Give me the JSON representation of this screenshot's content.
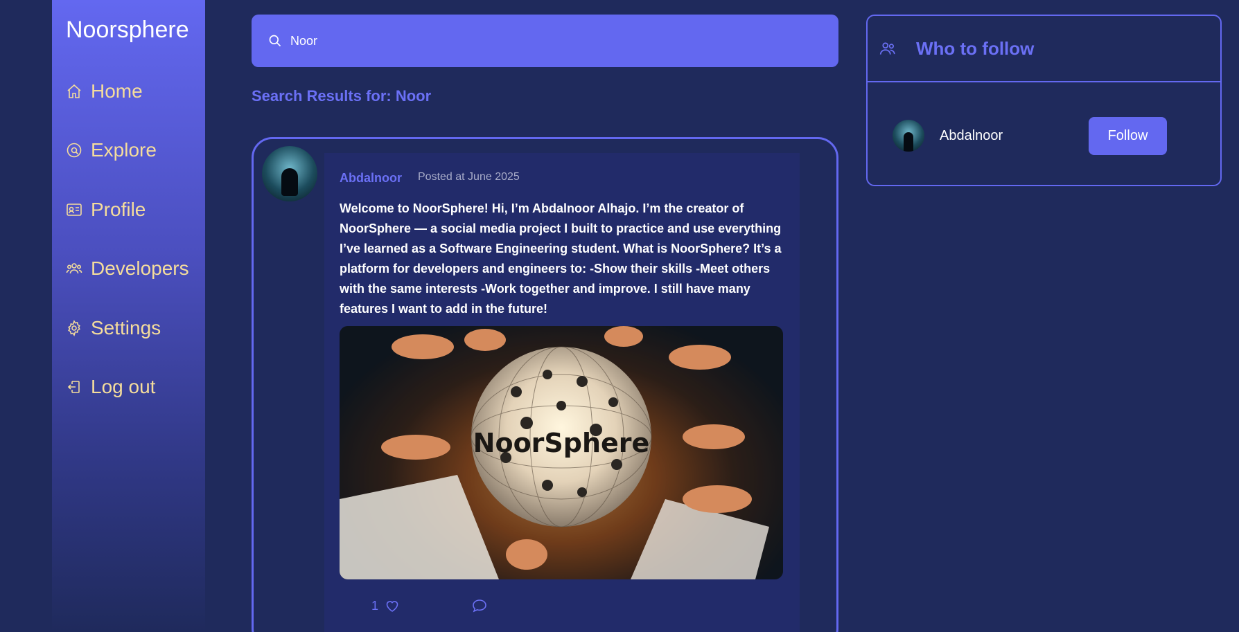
{
  "sidebar": {
    "brand": "Noorsphere",
    "items": [
      {
        "label": "Home",
        "icon": "home-icon"
      },
      {
        "label": "Explore",
        "icon": "explore-icon"
      },
      {
        "label": "Profile",
        "icon": "id-card-icon"
      },
      {
        "label": "Developers",
        "icon": "users-icon"
      },
      {
        "label": "Settings",
        "icon": "gear-icon"
      },
      {
        "label": "Log out",
        "icon": "logout-icon"
      }
    ]
  },
  "search": {
    "value": "Noor"
  },
  "results": {
    "heading": "Search Results for: Noor"
  },
  "post": {
    "author": "Abdalnoor",
    "time": "Posted at June 2025",
    "body": "Welcome to NoorSphere! Hi, I’m Abdalnoor Alhajo. I’m the creator of NoorSphere — a social media project I built to practice and use everything I’ve learned as a Software Engineering student. What is NoorSphere? It’s a platform for developers and engineers to: -Show their skills -Meet others with the same interests -Work together and improve. I still have many features I want to add in the future!",
    "image_text": "NoorSphere",
    "likes": "1"
  },
  "follow": {
    "title": "Who to follow",
    "users": [
      {
        "name": "Abdalnoor",
        "button": "Follow"
      }
    ]
  },
  "colors": {
    "background": "#1f2a5c",
    "accent": "#6368f0",
    "nav_text": "#f5dd9c",
    "post_bg": "#222b6a"
  }
}
